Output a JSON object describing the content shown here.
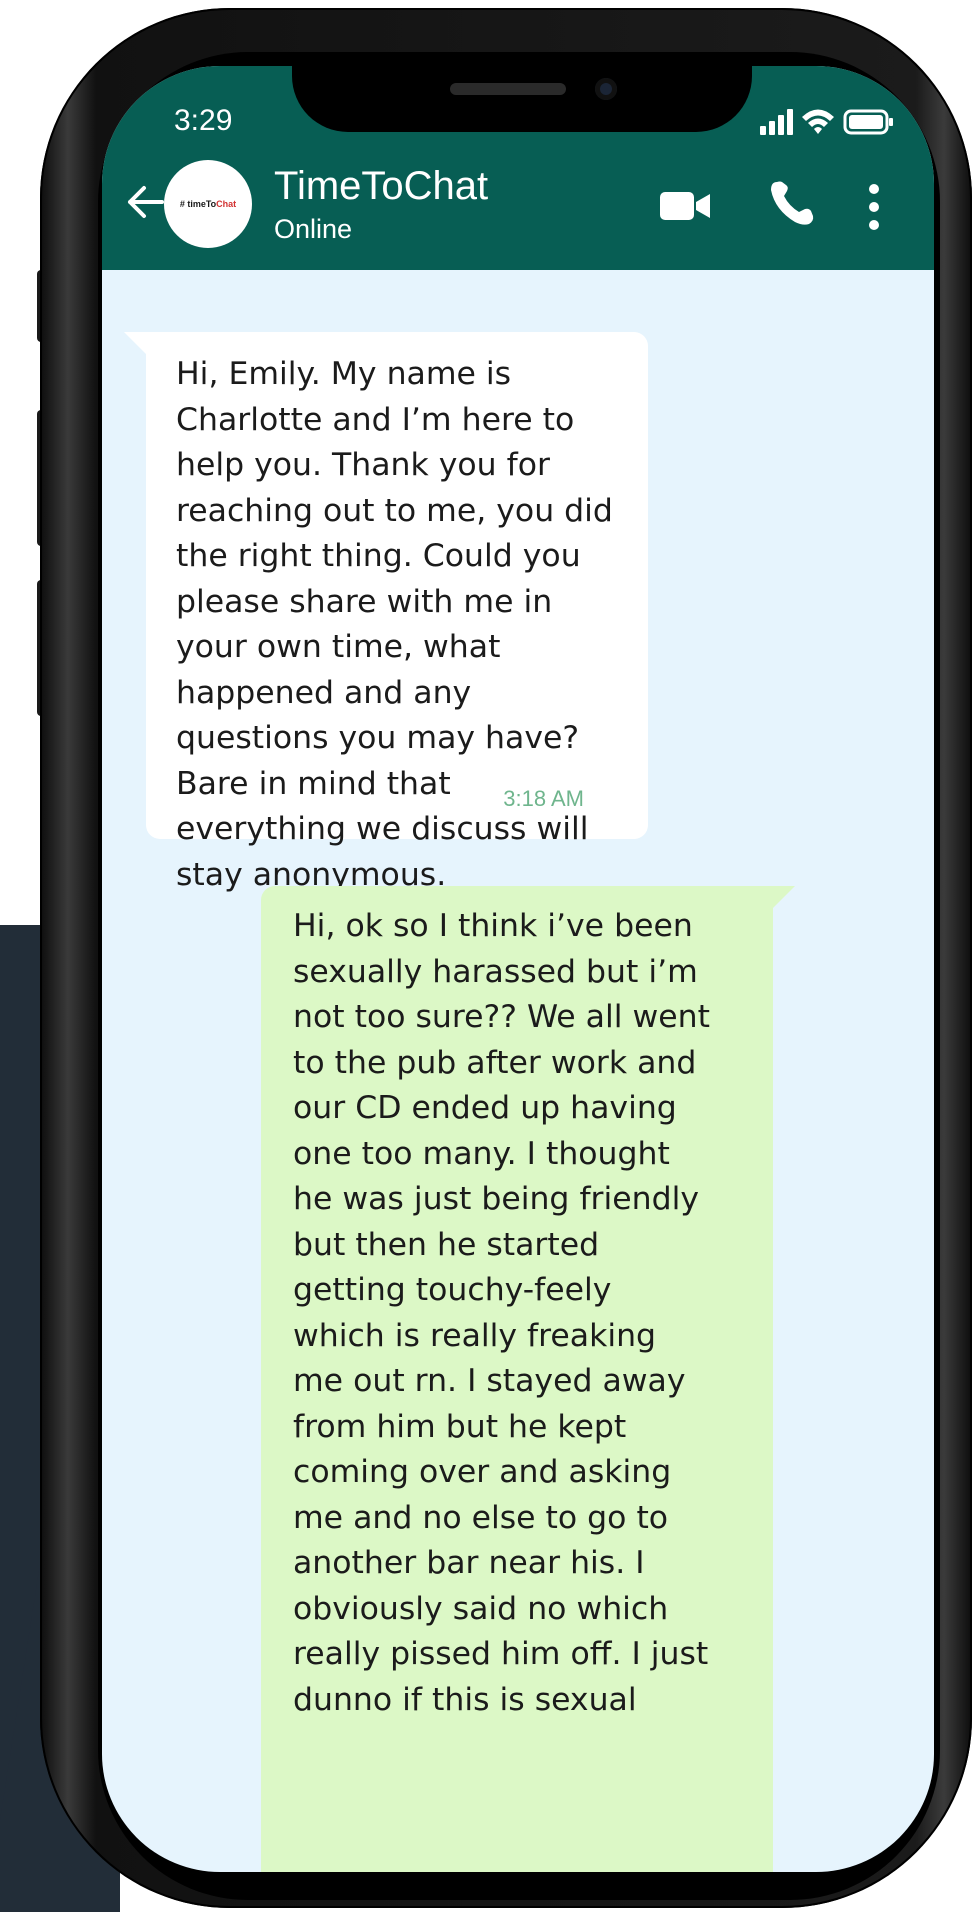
{
  "status_bar": {
    "time": "3:29"
  },
  "header": {
    "contact_name": "TimeToChat",
    "contact_status": "Online",
    "avatar_logo": {
      "prefix": "# timeTo",
      "accent": "Chat",
      "accent_color": "#d23232"
    },
    "color": "#075e54"
  },
  "messages": [
    {
      "direction": "incoming",
      "lines": [
        "Hi, Emily. My name is",
        "Charlotte and I’m here to",
        "help you. Thank you for",
        "reaching out to me, you did",
        "the right thing. Could you",
        "please share with me in",
        "your own time, what",
        "happened and any",
        "questions you may have?",
        "Bare in mind that",
        "everything we discuss will",
        "stay anonymous."
      ],
      "time": "3:18 AM"
    },
    {
      "direction": "outgoing",
      "lines": [
        "Hi, ok so I think i’ve been",
        "sexually harassed but i’m",
        "not too sure?? We all went",
        "to the pub after work and",
        "our CD ended up having",
        "one too many. I thought",
        "he was just being friendly",
        "but then he started",
        "getting touchy-feely",
        "which is really freaking",
        "me out rn. I stayed away",
        "from him but he kept",
        "coming over and asking",
        "me and no else to go to",
        "another bar near his. I",
        "obviously said no which",
        "really pissed him off. I just",
        "dunno if this is sexual"
      ]
    }
  ],
  "colors": {
    "chat_background": "#e6f4fd",
    "incoming_bubble": "#ffffff",
    "outgoing_bubble": "#dcf8c6",
    "timestamp": "#6fb58d"
  }
}
